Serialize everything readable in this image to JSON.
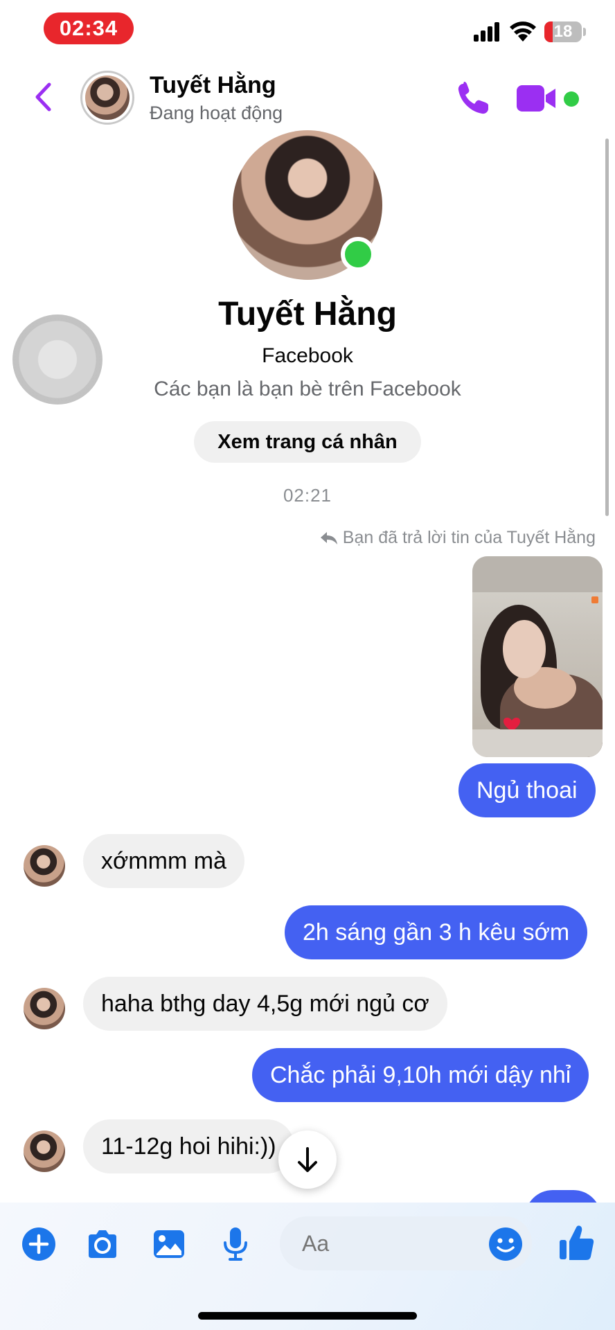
{
  "status_bar": {
    "time": "02:34",
    "battery": "18"
  },
  "header": {
    "name": "Tuyết Hằng",
    "status": "Đang hoạt động"
  },
  "profile": {
    "name": "Tuyết Hằng",
    "platform": "Facebook",
    "friends_note": "Các bạn là bạn bè trên Facebook",
    "view_profile_label": "Xem trang cá nhân"
  },
  "conversation": {
    "timestamp": "02:21",
    "reply_note": "Bạn đã trả lời tin của Tuyết Hằng",
    "messages": [
      {
        "direction": "out",
        "text": "Ngủ thoai"
      },
      {
        "direction": "in",
        "text": "xớmmm mà"
      },
      {
        "direction": "out",
        "text": "2h sáng gần 3 h kêu sớm"
      },
      {
        "direction": "in",
        "text": "haha bthg day 4,5g mới ngủ cơ"
      },
      {
        "direction": "out",
        "text": "Chắc phải 9,10h mới dậy nhỉ"
      },
      {
        "direction": "in",
        "text": "11-12g hoi hihi:))"
      }
    ]
  },
  "composer": {
    "placeholder": "Aa",
    "icons": [
      "add-icon",
      "camera-icon",
      "gallery-icon",
      "microphone-icon",
      "emoji-icon",
      "like-icon"
    ]
  },
  "colors": {
    "accent": "#9b2ff2",
    "outgoing_bubble": "#4461f2",
    "incoming_bubble": "#f0f0f0",
    "online": "#31cc46",
    "composer_icon": "#1c76ea"
  }
}
